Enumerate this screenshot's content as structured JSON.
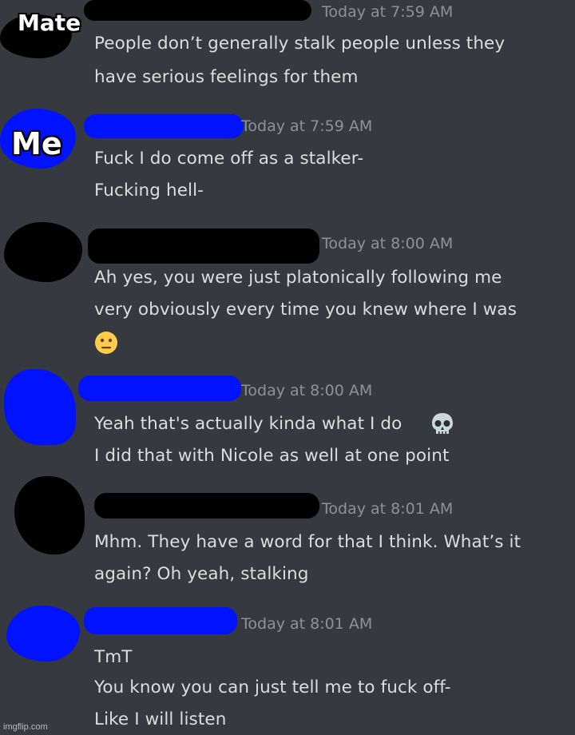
{
  "labels": {
    "mate": "Mate",
    "me": "Me"
  },
  "messages": [
    {
      "author": "mate",
      "timestamp": "Today at 7:59 AM",
      "lines": [
        "People don’t generally stalk people unless they",
        "have serious feelings for them"
      ]
    },
    {
      "author": "me",
      "timestamp": "Today at 7:59 AM",
      "lines": [
        "Fuck I do come off as a stalker-",
        "Fucking hell-"
      ]
    },
    {
      "author": "mate",
      "timestamp": "Today at 8:00 AM",
      "lines": [
        "Ah yes, you were just platonically following me",
        "very obviously every time you knew where I was"
      ],
      "emoji": "neutral-face-emoji"
    },
    {
      "author": "me",
      "timestamp": "Today at 8:00 AM",
      "lines": [
        "Yeah that's actually kinda what I do",
        "I did that with Nicole as well at one point"
      ],
      "emoji": "skull-emoji"
    },
    {
      "author": "mate",
      "timestamp": "Today at 8:01 AM",
      "lines": [
        "Mhm. They have a word for that I think. What’s it",
        "again? Oh yeah, stalking"
      ]
    },
    {
      "author": "me",
      "timestamp": "Today at 8:01 AM",
      "lines": [
        "TmT",
        "You know you can just tell me to fuck off-",
        "Like I will listen"
      ]
    }
  ],
  "watermark": "imgflip.com",
  "colors": {
    "background": "#36393f",
    "text": "#dcddde",
    "timestamp": "#8e9297",
    "mate_redaction": "#000000",
    "me_redaction": "#0012ff"
  }
}
